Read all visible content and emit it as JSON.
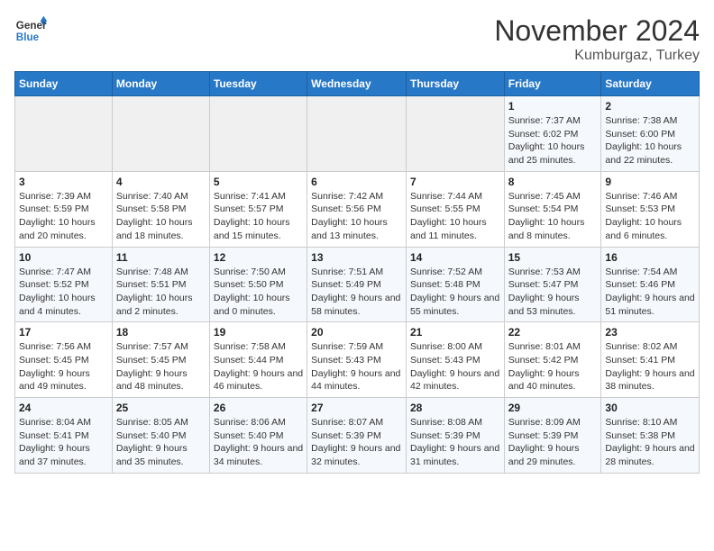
{
  "header": {
    "logo_line1": "General",
    "logo_line2": "Blue",
    "month_title": "November 2024",
    "subtitle": "Kumburgaz, Turkey"
  },
  "weekdays": [
    "Sunday",
    "Monday",
    "Tuesday",
    "Wednesday",
    "Thursday",
    "Friday",
    "Saturday"
  ],
  "weeks": [
    [
      {
        "day": "",
        "info": ""
      },
      {
        "day": "",
        "info": ""
      },
      {
        "day": "",
        "info": ""
      },
      {
        "day": "",
        "info": ""
      },
      {
        "day": "",
        "info": ""
      },
      {
        "day": "1",
        "info": "Sunrise: 7:37 AM\nSunset: 6:02 PM\nDaylight: 10 hours and 25 minutes."
      },
      {
        "day": "2",
        "info": "Sunrise: 7:38 AM\nSunset: 6:00 PM\nDaylight: 10 hours and 22 minutes."
      }
    ],
    [
      {
        "day": "3",
        "info": "Sunrise: 7:39 AM\nSunset: 5:59 PM\nDaylight: 10 hours and 20 minutes."
      },
      {
        "day": "4",
        "info": "Sunrise: 7:40 AM\nSunset: 5:58 PM\nDaylight: 10 hours and 18 minutes."
      },
      {
        "day": "5",
        "info": "Sunrise: 7:41 AM\nSunset: 5:57 PM\nDaylight: 10 hours and 15 minutes."
      },
      {
        "day": "6",
        "info": "Sunrise: 7:42 AM\nSunset: 5:56 PM\nDaylight: 10 hours and 13 minutes."
      },
      {
        "day": "7",
        "info": "Sunrise: 7:44 AM\nSunset: 5:55 PM\nDaylight: 10 hours and 11 minutes."
      },
      {
        "day": "8",
        "info": "Sunrise: 7:45 AM\nSunset: 5:54 PM\nDaylight: 10 hours and 8 minutes."
      },
      {
        "day": "9",
        "info": "Sunrise: 7:46 AM\nSunset: 5:53 PM\nDaylight: 10 hours and 6 minutes."
      }
    ],
    [
      {
        "day": "10",
        "info": "Sunrise: 7:47 AM\nSunset: 5:52 PM\nDaylight: 10 hours and 4 minutes."
      },
      {
        "day": "11",
        "info": "Sunrise: 7:48 AM\nSunset: 5:51 PM\nDaylight: 10 hours and 2 minutes."
      },
      {
        "day": "12",
        "info": "Sunrise: 7:50 AM\nSunset: 5:50 PM\nDaylight: 10 hours and 0 minutes."
      },
      {
        "day": "13",
        "info": "Sunrise: 7:51 AM\nSunset: 5:49 PM\nDaylight: 9 hours and 58 minutes."
      },
      {
        "day": "14",
        "info": "Sunrise: 7:52 AM\nSunset: 5:48 PM\nDaylight: 9 hours and 55 minutes."
      },
      {
        "day": "15",
        "info": "Sunrise: 7:53 AM\nSunset: 5:47 PM\nDaylight: 9 hours and 53 minutes."
      },
      {
        "day": "16",
        "info": "Sunrise: 7:54 AM\nSunset: 5:46 PM\nDaylight: 9 hours and 51 minutes."
      }
    ],
    [
      {
        "day": "17",
        "info": "Sunrise: 7:56 AM\nSunset: 5:45 PM\nDaylight: 9 hours and 49 minutes."
      },
      {
        "day": "18",
        "info": "Sunrise: 7:57 AM\nSunset: 5:45 PM\nDaylight: 9 hours and 48 minutes."
      },
      {
        "day": "19",
        "info": "Sunrise: 7:58 AM\nSunset: 5:44 PM\nDaylight: 9 hours and 46 minutes."
      },
      {
        "day": "20",
        "info": "Sunrise: 7:59 AM\nSunset: 5:43 PM\nDaylight: 9 hours and 44 minutes."
      },
      {
        "day": "21",
        "info": "Sunrise: 8:00 AM\nSunset: 5:43 PM\nDaylight: 9 hours and 42 minutes."
      },
      {
        "day": "22",
        "info": "Sunrise: 8:01 AM\nSunset: 5:42 PM\nDaylight: 9 hours and 40 minutes."
      },
      {
        "day": "23",
        "info": "Sunrise: 8:02 AM\nSunset: 5:41 PM\nDaylight: 9 hours and 38 minutes."
      }
    ],
    [
      {
        "day": "24",
        "info": "Sunrise: 8:04 AM\nSunset: 5:41 PM\nDaylight: 9 hours and 37 minutes."
      },
      {
        "day": "25",
        "info": "Sunrise: 8:05 AM\nSunset: 5:40 PM\nDaylight: 9 hours and 35 minutes."
      },
      {
        "day": "26",
        "info": "Sunrise: 8:06 AM\nSunset: 5:40 PM\nDaylight: 9 hours and 34 minutes."
      },
      {
        "day": "27",
        "info": "Sunrise: 8:07 AM\nSunset: 5:39 PM\nDaylight: 9 hours and 32 minutes."
      },
      {
        "day": "28",
        "info": "Sunrise: 8:08 AM\nSunset: 5:39 PM\nDaylight: 9 hours and 31 minutes."
      },
      {
        "day": "29",
        "info": "Sunrise: 8:09 AM\nSunset: 5:39 PM\nDaylight: 9 hours and 29 minutes."
      },
      {
        "day": "30",
        "info": "Sunrise: 8:10 AM\nSunset: 5:38 PM\nDaylight: 9 hours and 28 minutes."
      }
    ]
  ]
}
